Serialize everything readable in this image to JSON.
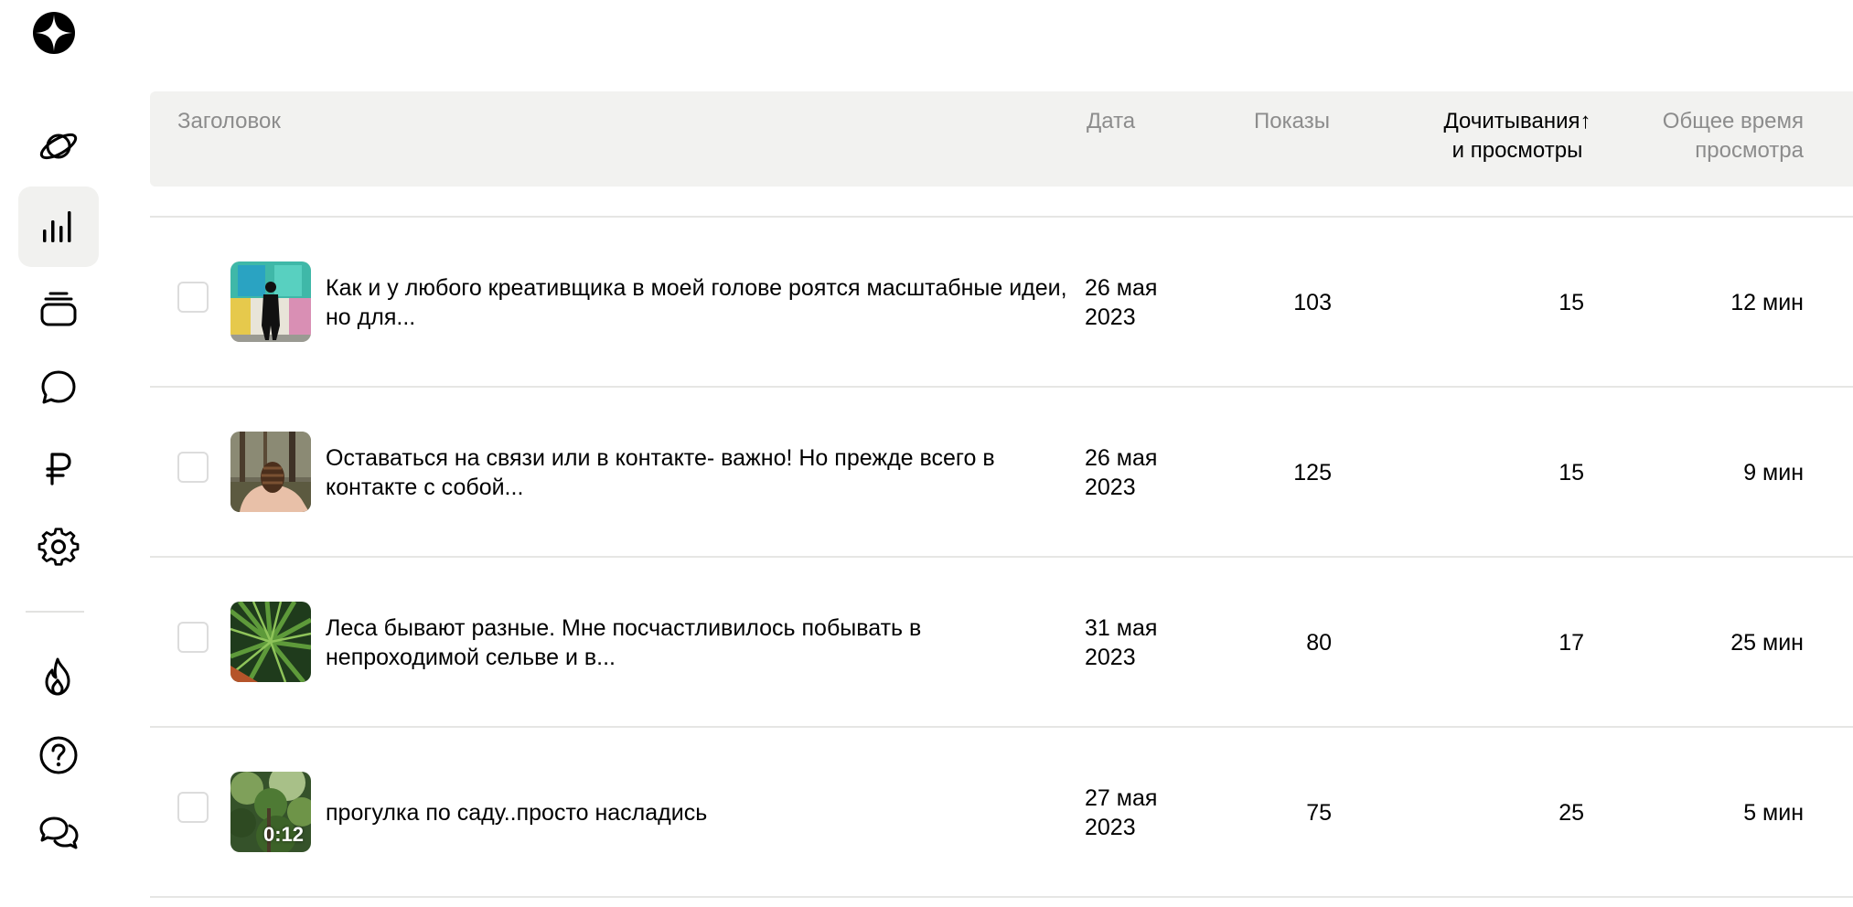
{
  "sidebar": {
    "logo": "star-logo-icon",
    "items": [
      {
        "name": "planet-icon",
        "active": false
      },
      {
        "name": "bar-chart-icon",
        "active": true
      },
      {
        "name": "stack-icon",
        "active": false
      },
      {
        "name": "chat-bubble-icon",
        "active": false
      },
      {
        "name": "ruble-icon",
        "active": false
      },
      {
        "name": "gear-icon",
        "active": false
      },
      {
        "name": "flame-icon",
        "active": false
      },
      {
        "name": "help-icon",
        "active": false
      },
      {
        "name": "messages-icon",
        "active": false
      }
    ]
  },
  "table": {
    "headers": {
      "title": "Заголовок",
      "date": "Дата",
      "impressions": "Показы",
      "reads_line1": "Дочитывания↑",
      "reads_line2": "и просмотры",
      "time_line1": "Общее время",
      "time_line2": "просмотра"
    },
    "rows": [
      {
        "title": "Как и у любого креативщика в моей голове роятся масштабные идеи, но для...",
        "date_line1": "26 мая",
        "date_line2": "2023",
        "impressions": "103",
        "reads": "15",
        "time": "12 мин",
        "thumb": "gallery-silhouette"
      },
      {
        "title": "Оставаться на связи или в контакте- важно! Но прежде всего в контакте с собой...",
        "date_line1": "26 мая",
        "date_line2": "2023",
        "impressions": "125",
        "reads": "15",
        "time": "9 мин",
        "thumb": "pinecone-hand"
      },
      {
        "title": "Леса бывают разные. Мне посчастливилось побывать в непроходимой сельве и в...",
        "date_line1": "31 мая",
        "date_line2": "2023",
        "impressions": "80",
        "reads": "17",
        "time": "25 мин",
        "thumb": "palm-leaves"
      },
      {
        "title": "прогулка по саду..просто насладись",
        "date_line1": "27 мая",
        "date_line2": "2023",
        "impressions": "75",
        "reads": "25",
        "time": "5 мин",
        "thumb": "garden-video",
        "duration": "0:12"
      }
    ]
  }
}
